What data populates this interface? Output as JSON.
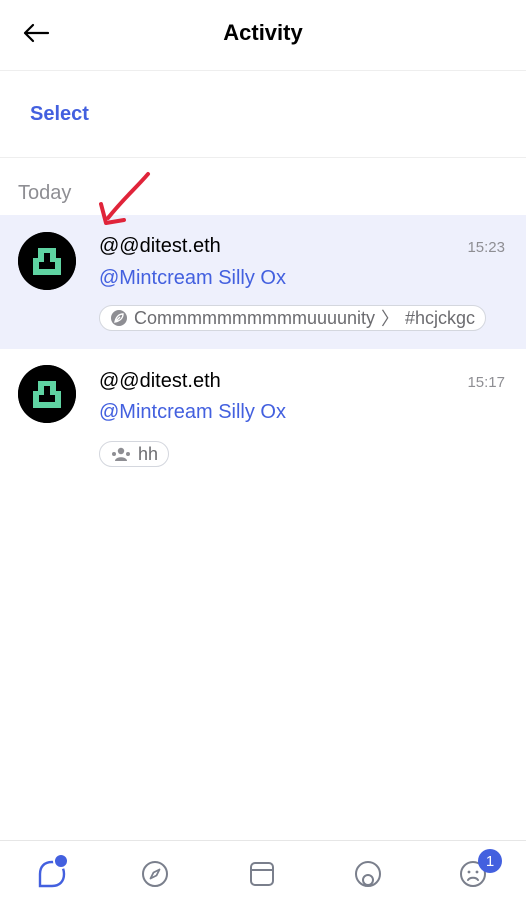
{
  "header": {
    "title": "Activity"
  },
  "toolbar": {
    "select_label": "Select"
  },
  "section": {
    "label": "Today"
  },
  "notifications": [
    {
      "author": "@@ditest.eth",
      "time": "15:23",
      "mention": "@Mintcream Silly Ox",
      "chip": {
        "community": "Commmmmmmmmmuuuunity",
        "separator": "〉",
        "channel": "#hcjckgc"
      },
      "highlighted": true
    },
    {
      "author": "@@ditest.eth",
      "time": "15:17",
      "mention": "@Mintcream Silly Ox",
      "chip": {
        "label": "hh"
      },
      "highlighted": false
    }
  ],
  "tabbar": {
    "profile_badge": "1"
  },
  "colors": {
    "accent": "#4360df",
    "highlight": "#eef0fc",
    "annotation": "#e0243a",
    "avatar_glyph": "#5fd3a2"
  }
}
